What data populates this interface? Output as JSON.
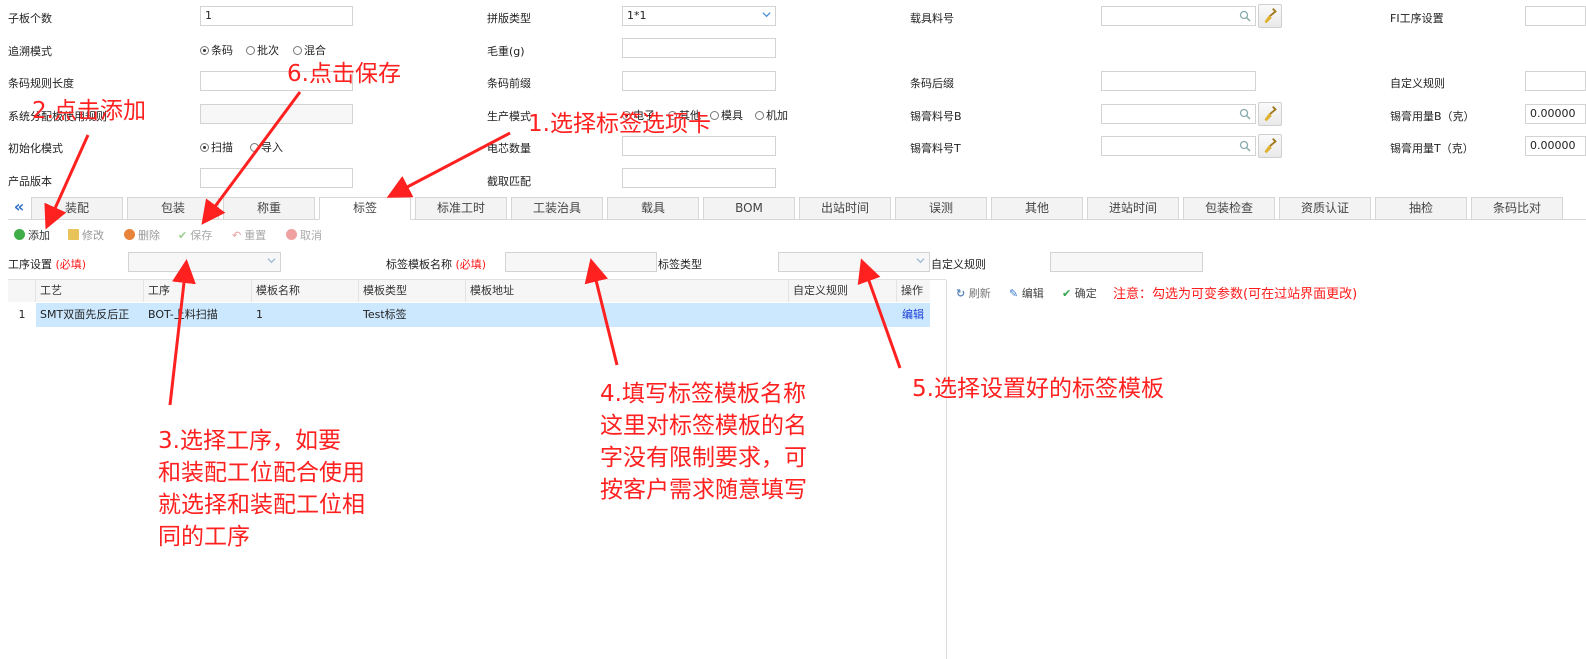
{
  "form": {
    "board_count": {
      "label": "子板个数",
      "value": "1"
    },
    "trace_mode": {
      "label": "追溯模式",
      "options": [
        "条码",
        "批次",
        "混合"
      ],
      "selected": "条码"
    },
    "barcode_rule_len": {
      "label": "条码规则长度",
      "value": ""
    },
    "system_assign": {
      "label": "系统分配板使用规则",
      "value": ""
    },
    "init_mode": {
      "label": "初始化模式",
      "options": [
        "扫描",
        "导入"
      ],
      "selected": "扫描"
    },
    "product_version": {
      "label": "产品版本",
      "value": ""
    },
    "panel_type": {
      "label": "拼版类型",
      "value": "1*1"
    },
    "gross_weight": {
      "label": "毛重(g)",
      "value": ""
    },
    "barcode_prefix": {
      "label": "条码前缀",
      "value": ""
    },
    "production_mode": {
      "label": "生产模式",
      "options": [
        "电子",
        "其他",
        "模具",
        "机加"
      ],
      "selected": "电子"
    },
    "cell_count": {
      "label": "电芯数量",
      "value": ""
    },
    "capture_match": {
      "label": "截取匹配",
      "value": ""
    },
    "carrier_no": {
      "label": "载具料号",
      "value": ""
    },
    "barcode_suffix": {
      "label": "条码后缀",
      "value": ""
    },
    "solder_b": {
      "label": "锡膏料号B",
      "value": ""
    },
    "solder_t": {
      "label": "锡膏料号T",
      "value": ""
    },
    "fi_process": {
      "label": "FI工序设置",
      "value": ""
    },
    "custom_rule": {
      "label": "自定义规则",
      "value": ""
    },
    "solder_b_qty": {
      "label": "锡膏用量B（克）",
      "value": "0.00000"
    },
    "solder_t_qty": {
      "label": "锡膏用量T（克）",
      "value": "0.00000"
    }
  },
  "tabs": [
    "装配",
    "包装",
    "称重",
    "标签",
    "标准工时",
    "工装治具",
    "载具",
    "BOM",
    "出站时间",
    "误测",
    "其他",
    "进站时间",
    "包装检查",
    "资质认证",
    "抽检",
    "条码比对"
  ],
  "active_tab": "标签",
  "toolbar": {
    "add": "添加",
    "edit": "修改",
    "delete": "删除",
    "save": "保存",
    "reset": "重置",
    "cancel": "取消"
  },
  "filter": {
    "process_label": "工序设置",
    "required": "(必填)",
    "template_name_label": "标签模板名称",
    "template_type_label": "标签类型",
    "custom_rule_label": "自定义规则"
  },
  "table": {
    "headers": [
      "工艺",
      "工序",
      "模板名称",
      "模板类型",
      "模板地址",
      "自定义规则",
      "操作"
    ],
    "rows": [
      {
        "no": "1",
        "craft": "SMT双面先反后正",
        "process": "BOT-上料扫描",
        "template_name": "1",
        "template_type": "Test标签",
        "template_addr": "",
        "custom_rule": "",
        "action": "编辑"
      }
    ]
  },
  "right_toolbar": {
    "refresh": "刷新",
    "edit": "编辑",
    "confirm": "确定",
    "note": "注意：勾选为可变参数(可在过站界面更改)"
  },
  "annotations": {
    "a1": "1.选择标签选项卡",
    "a2": "2.点击添加",
    "a3": [
      "3.选择工序，如要",
      "和装配工位配合使用",
      "就选择和装配工位相",
      "同的工序"
    ],
    "a4": [
      "4.填写标签模板名称",
      "这里对标签模板的名",
      "字没有限制要求，可",
      "按客户需求随意填写"
    ],
    "a5": "5.选择设置好的标签模板",
    "a6": "6.点击保存"
  },
  "colors": {
    "annotation": "#ff2020",
    "selected_row": "#cce8ff",
    "required": "#ff1a1a",
    "link": "#1a3fd6"
  }
}
